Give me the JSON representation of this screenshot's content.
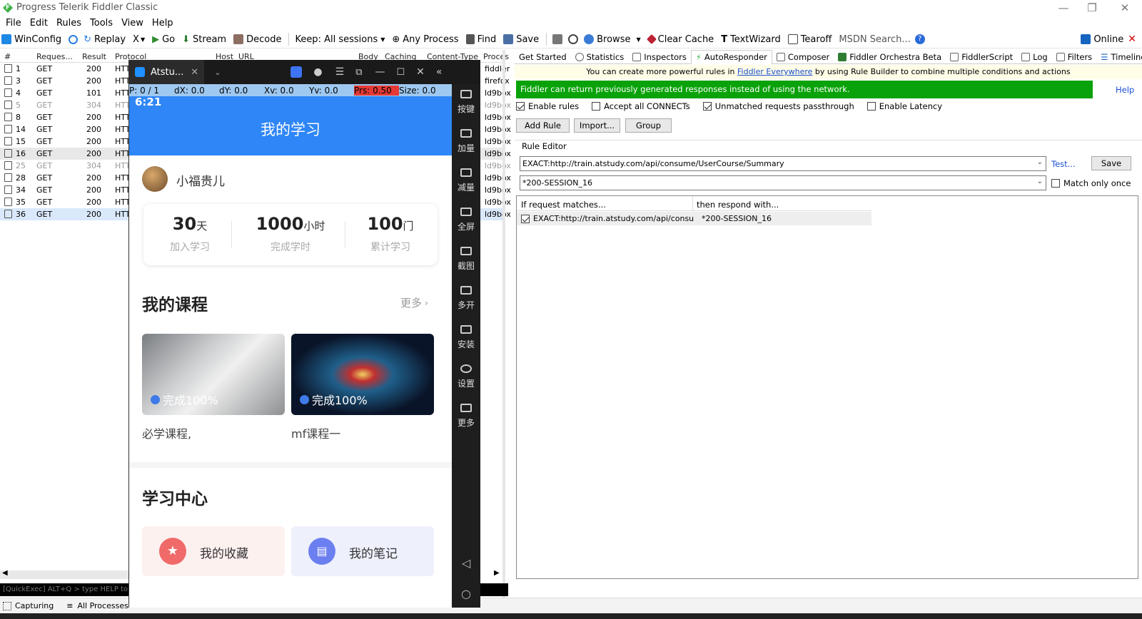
{
  "window": {
    "title": "Progress Telerik Fiddler Classic",
    "logo_letter": "F"
  },
  "menu": [
    "File",
    "Edit",
    "Rules",
    "Tools",
    "View",
    "Help"
  ],
  "toolbar": {
    "items": [
      "WinConfig",
      "Replay",
      "X",
      "Go",
      "Stream",
      "Decode",
      "Keep: All sessions",
      "Any Process",
      "Find",
      "Save",
      "Browse",
      "Clear Cache",
      "TextWizard",
      "Tearoff"
    ],
    "search_placeholder": "MSDN Search...",
    "online": "Online"
  },
  "sessions": {
    "columns": [
      "#",
      "Reques...",
      "Result",
      "Protocol",
      "Host",
      "URL",
      "Body",
      "Caching",
      "Content-Type",
      "Proces"
    ],
    "rows": [
      {
        "id": "1",
        "method": "GET",
        "result": "200",
        "proto": "HTT",
        "proc": "fiddler",
        "gray": false
      },
      {
        "id": "3",
        "method": "GET",
        "result": "200",
        "proto": "HTT",
        "proc": "firefox",
        "gray": false
      },
      {
        "id": "4",
        "method": "GET",
        "result": "101",
        "proto": "HTT",
        "proc": "ld9box",
        "gray": false
      },
      {
        "id": "5",
        "method": "GET",
        "result": "304",
        "proto": "HTT",
        "proc": "ld9box",
        "gray": true
      },
      {
        "id": "8",
        "method": "GET",
        "result": "200",
        "proto": "HTT",
        "proc": "ld9box",
        "gray": false
      },
      {
        "id": "14",
        "method": "GET",
        "result": "200",
        "proto": "HTT",
        "proc": "ld9box",
        "gray": false
      },
      {
        "id": "15",
        "method": "GET",
        "result": "200",
        "proto": "HTT",
        "proc": "ld9box",
        "gray": false
      },
      {
        "id": "16",
        "method": "GET",
        "result": "200",
        "proto": "HTT",
        "proc": "ld9box",
        "gray": false
      },
      {
        "id": "25",
        "method": "GET",
        "result": "304",
        "proto": "HTT",
        "proc": "ld9box",
        "gray": true
      },
      {
        "id": "28",
        "method": "GET",
        "result": "200",
        "proto": "HTT",
        "proc": "ld9box",
        "gray": false
      },
      {
        "id": "34",
        "method": "GET",
        "result": "200",
        "proto": "HTT",
        "proc": "ld9box",
        "gray": false
      },
      {
        "id": "35",
        "method": "GET",
        "result": "200",
        "proto": "HTT",
        "proc": "ld9box",
        "gray": false
      },
      {
        "id": "36",
        "method": "GET",
        "result": "200",
        "proto": "HTT",
        "proc": "ld9box",
        "gray": false
      }
    ]
  },
  "quickexec": "[QuickExec] ALT+Q > type HELP to le",
  "status": {
    "capturing": "Capturing",
    "processes": "All Processes"
  },
  "emulator": {
    "tab_title": "Atstu...",
    "pointer": {
      "p": "P: 0 / 1",
      "dx": "dX: 0.0",
      "dy": "dY: 0.0",
      "xv": "Xv: 0.0",
      "yv": "Yv: 0.0",
      "prs": "Prs: 0.50",
      "size": "Size: 0.0"
    },
    "time": "6:21",
    "sidebar": [
      "按键",
      "加量",
      "减量",
      "全屏",
      "截图",
      "多开",
      "安装",
      "设置",
      "更多"
    ],
    "app": {
      "title": "我的学习",
      "username": "小福贵儿",
      "stats": [
        {
          "num": "30",
          "unit": "天",
          "label": "加入学习"
        },
        {
          "num": "1000",
          "unit": "小时",
          "label": "完成学时"
        },
        {
          "num": "100",
          "unit": "门",
          "label": "累计学习"
        }
      ],
      "courses_title": "我的课程",
      "more": "更多",
      "courses": [
        {
          "progress": "完成100%",
          "name": "必学课程,"
        },
        {
          "progress": "完成100%",
          "name": "mf课程一"
        }
      ],
      "center_title": "学习中心",
      "tiles": [
        "我的收藏",
        "我的笔记"
      ]
    }
  },
  "right": {
    "tabs": [
      "Get Started",
      "Statistics",
      "Inspectors",
      "AutoResponder",
      "Composer",
      "Fiddler Orchestra Beta",
      "FiddlerScript",
      "Log",
      "Filters",
      "Timeline"
    ],
    "promo_prefix": "You can create more powerful rules in ",
    "promo_link": "Fiddler Everywhere",
    "promo_suffix": " by using Rule Builder to combine multiple conditions and actions",
    "banner": "Fiddler can return previously generated responses instead of using the network.",
    "help": "Help",
    "options": [
      {
        "label": "Enable rules",
        "checked": true
      },
      {
        "label": "Accept all CONNECTs",
        "checked": false
      },
      {
        "label": "Unmatched requests passthrough",
        "checked": true
      },
      {
        "label": "Enable Latency",
        "checked": false
      }
    ],
    "buttons": [
      "Add Rule",
      "Import...",
      "Group"
    ],
    "rule_editor": "Rule Editor",
    "match_value": "EXACT:http://train.atstudy.com/api/consume/UserCourse/Summary",
    "respond_value": "*200-SESSION_16",
    "test": "Test...",
    "save": "Save",
    "match_once": "Match only once",
    "grid_headers": [
      "If request matches...",
      "then respond with..."
    ],
    "rule_row": {
      "match": "EXACT:http://train.atstudy.com/api/consum...",
      "respond": "*200-SESSION_16"
    }
  }
}
